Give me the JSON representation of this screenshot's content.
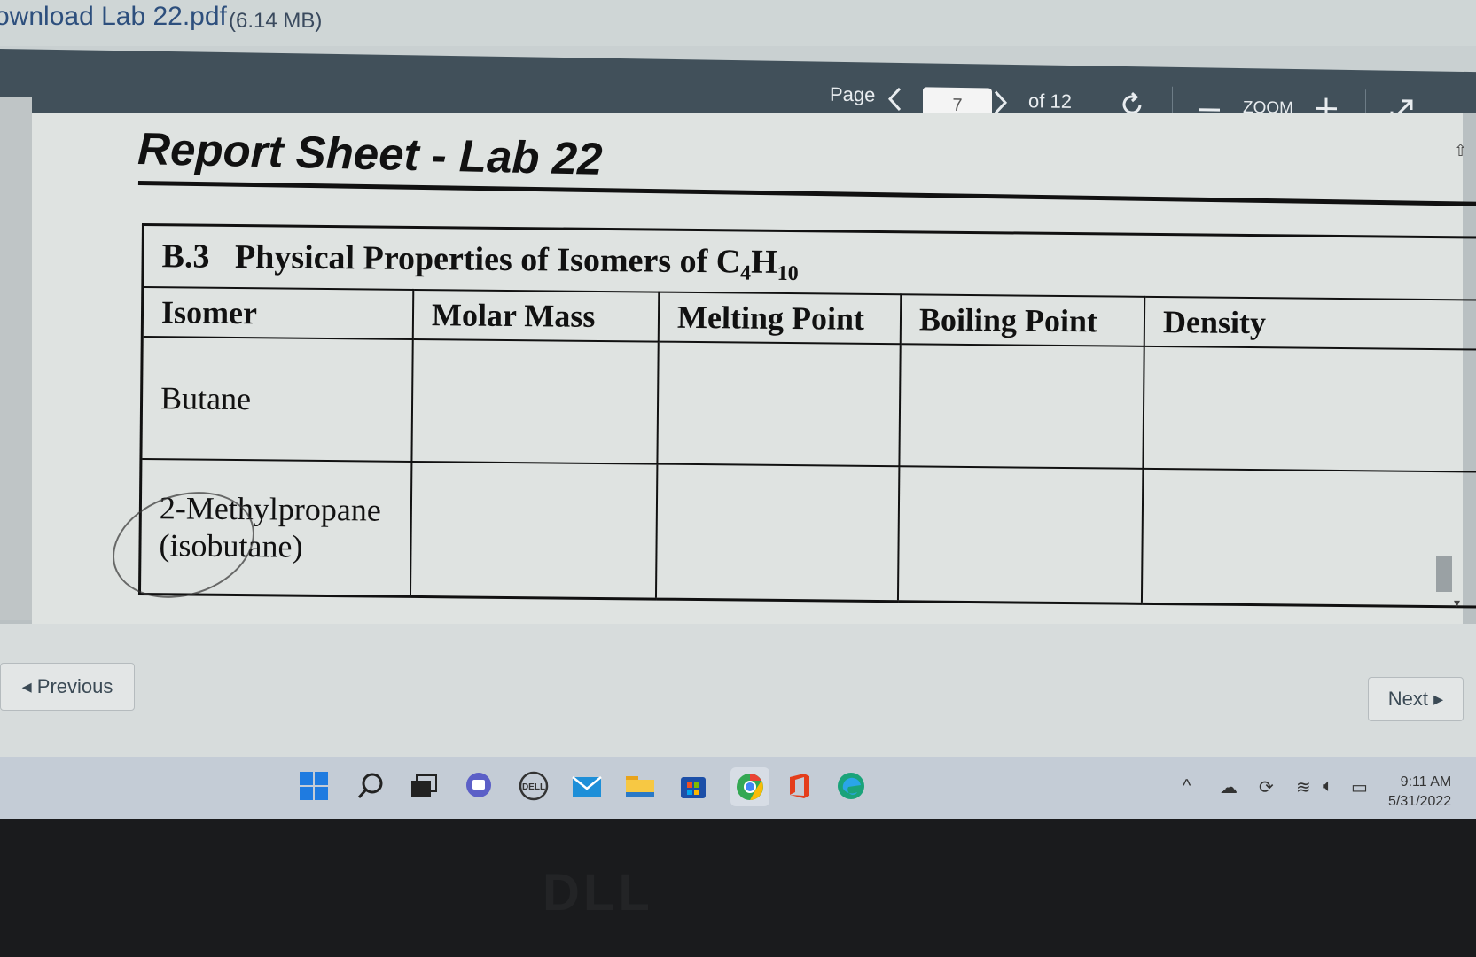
{
  "topbar": {
    "filename": "ownload Lab 22.pdf",
    "filesize": "(6.14 MB)"
  },
  "toolbar": {
    "page_label": "Page",
    "current_page": "7",
    "of_pages": "of 12",
    "zoom_label": "ZOOM",
    "icons": [
      "chevron-left-icon",
      "chevron-right-icon",
      "rotate-icon",
      "minus-icon",
      "plus-icon",
      "expand-icon"
    ]
  },
  "document": {
    "title": "Report Sheet - Lab 22",
    "section_number": "B.3",
    "section_title": "Physical Properties of Isomers of C",
    "formula_sub1": "4",
    "formula_h": "H",
    "formula_sub2": "10",
    "table": {
      "headers": [
        "Isomer",
        "Molar Mass",
        "Melting Point",
        "Boiling Point",
        "Density"
      ],
      "rows": [
        {
          "isomer": "Butane",
          "isomer2": ""
        },
        {
          "isomer": "2-Methylpropane",
          "isomer2": "(isobutane)"
        }
      ]
    }
  },
  "nav": {
    "previous": "◂ Previous",
    "next": "Next ▸"
  },
  "taskbar": {
    "apps": [
      "windows-start-icon",
      "search-icon",
      "task-view-icon",
      "teams-chat-icon",
      "dell-icon",
      "mail-icon",
      "file-explorer-icon",
      "store-icon",
      "chrome-icon",
      "office-icon",
      "edge-icon"
    ],
    "time": "9:11 AM",
    "date": "5/31/2022"
  },
  "colors": {
    "toolbar": "#41505a",
    "page": "#dfe3e1",
    "taskbar": "#c4ccd6"
  }
}
